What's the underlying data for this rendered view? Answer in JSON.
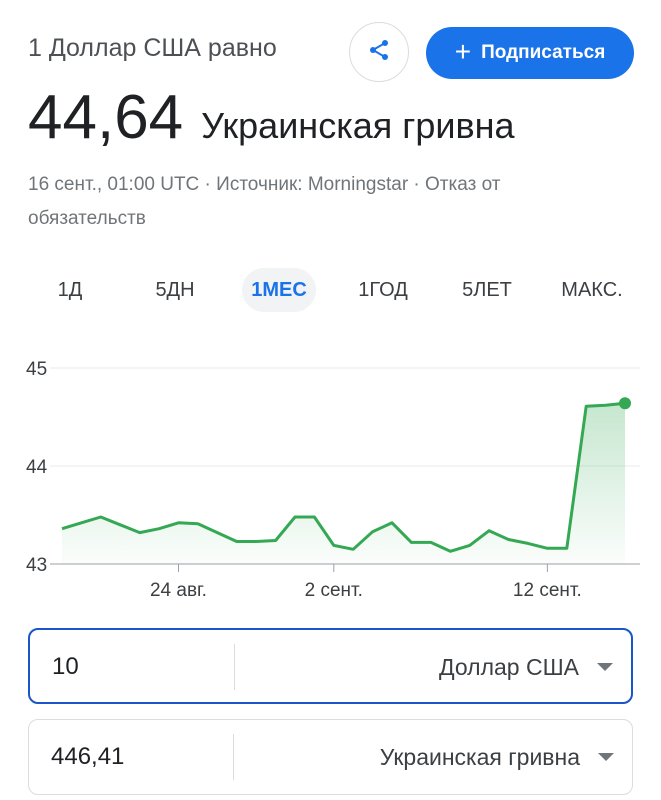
{
  "header": {
    "subtitle": "1 Доллар США равно",
    "value": "44,64",
    "currency_name": "Украинская гривна",
    "source_line": "16 сент., 01:00 UTC · Источник: Morningstar · Отказ от обязательств",
    "subscribe_label": "Подписаться",
    "share_icon": "share-icon",
    "accent_color": "#1a73e8"
  },
  "tabs": [
    {
      "label": "1Д",
      "active": false
    },
    {
      "label": "5ДН",
      "active": false
    },
    {
      "label": "1МЕС",
      "active": true
    },
    {
      "label": "1ГОД",
      "active": false
    },
    {
      "label": "5ЛЕТ",
      "active": false
    },
    {
      "label": "МАКС.",
      "active": false
    }
  ],
  "chart_data": {
    "type": "area",
    "title": "",
    "xlabel": "",
    "ylabel": "",
    "y_ticks": [
      "45",
      "44",
      "43"
    ],
    "x_ticks": [
      "24 авг.",
      "2 сент.",
      "12 сент."
    ],
    "ylim": [
      43,
      45
    ],
    "grid": true,
    "line_color": "#34a853",
    "series": [
      {
        "values": [
          43.36,
          43.42,
          43.48,
          43.4,
          43.32,
          43.36,
          43.42,
          43.41,
          43.32,
          43.23,
          43.23,
          43.24,
          43.48,
          43.48,
          43.19,
          43.15,
          43.33,
          43.42,
          43.22,
          43.22,
          43.13,
          43.19,
          43.34,
          43.25,
          43.21,
          43.16,
          43.16,
          44.61,
          44.62,
          44.64
        ]
      }
    ]
  },
  "converter": {
    "from_amount": "10",
    "from_currency": "Доллар США",
    "to_amount": "446,41",
    "to_currency": "Украинская гривна"
  }
}
